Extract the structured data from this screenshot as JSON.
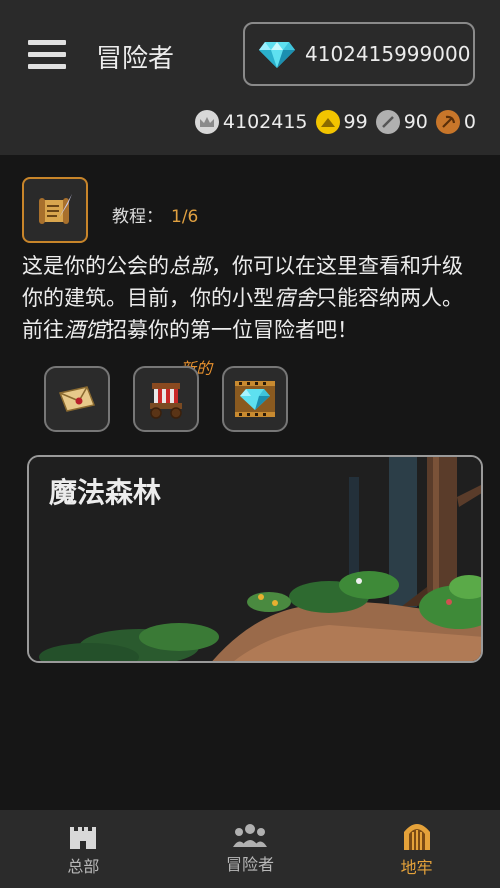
{
  "header": {
    "title": "冒险者",
    "gems": "4102415999000",
    "resources": [
      {
        "name": "crown-coin",
        "value": "4102415",
        "color": "#d8d8d8"
      },
      {
        "name": "gold-coin",
        "value": "99",
        "color": "#f2c400"
      },
      {
        "name": "sword-coin",
        "value": "90",
        "color": "#b0b0b0"
      },
      {
        "name": "pickaxe-coin",
        "value": "0",
        "color": "#c8762a"
      }
    ]
  },
  "tutorial": {
    "label": "教程：",
    "progress": "1/6",
    "text_parts": [
      "这是你的公会的",
      "总部",
      "，你可以在这里查看和升级你的建筑。目前，你的小型",
      "宿舍",
      "只能容纳两人。前往",
      "酒馆",
      "招募你的第一位冒险者吧！"
    ]
  },
  "icons": {
    "new_badge": "新的"
  },
  "dungeon": {
    "name": "魔法森林"
  },
  "nav": {
    "items": [
      {
        "label": "总部",
        "icon": "castle-icon"
      },
      {
        "label": "冒险者",
        "icon": "group-icon"
      },
      {
        "label": "地牢",
        "icon": "dungeon-gate-icon"
      }
    ],
    "active": "地牢"
  }
}
